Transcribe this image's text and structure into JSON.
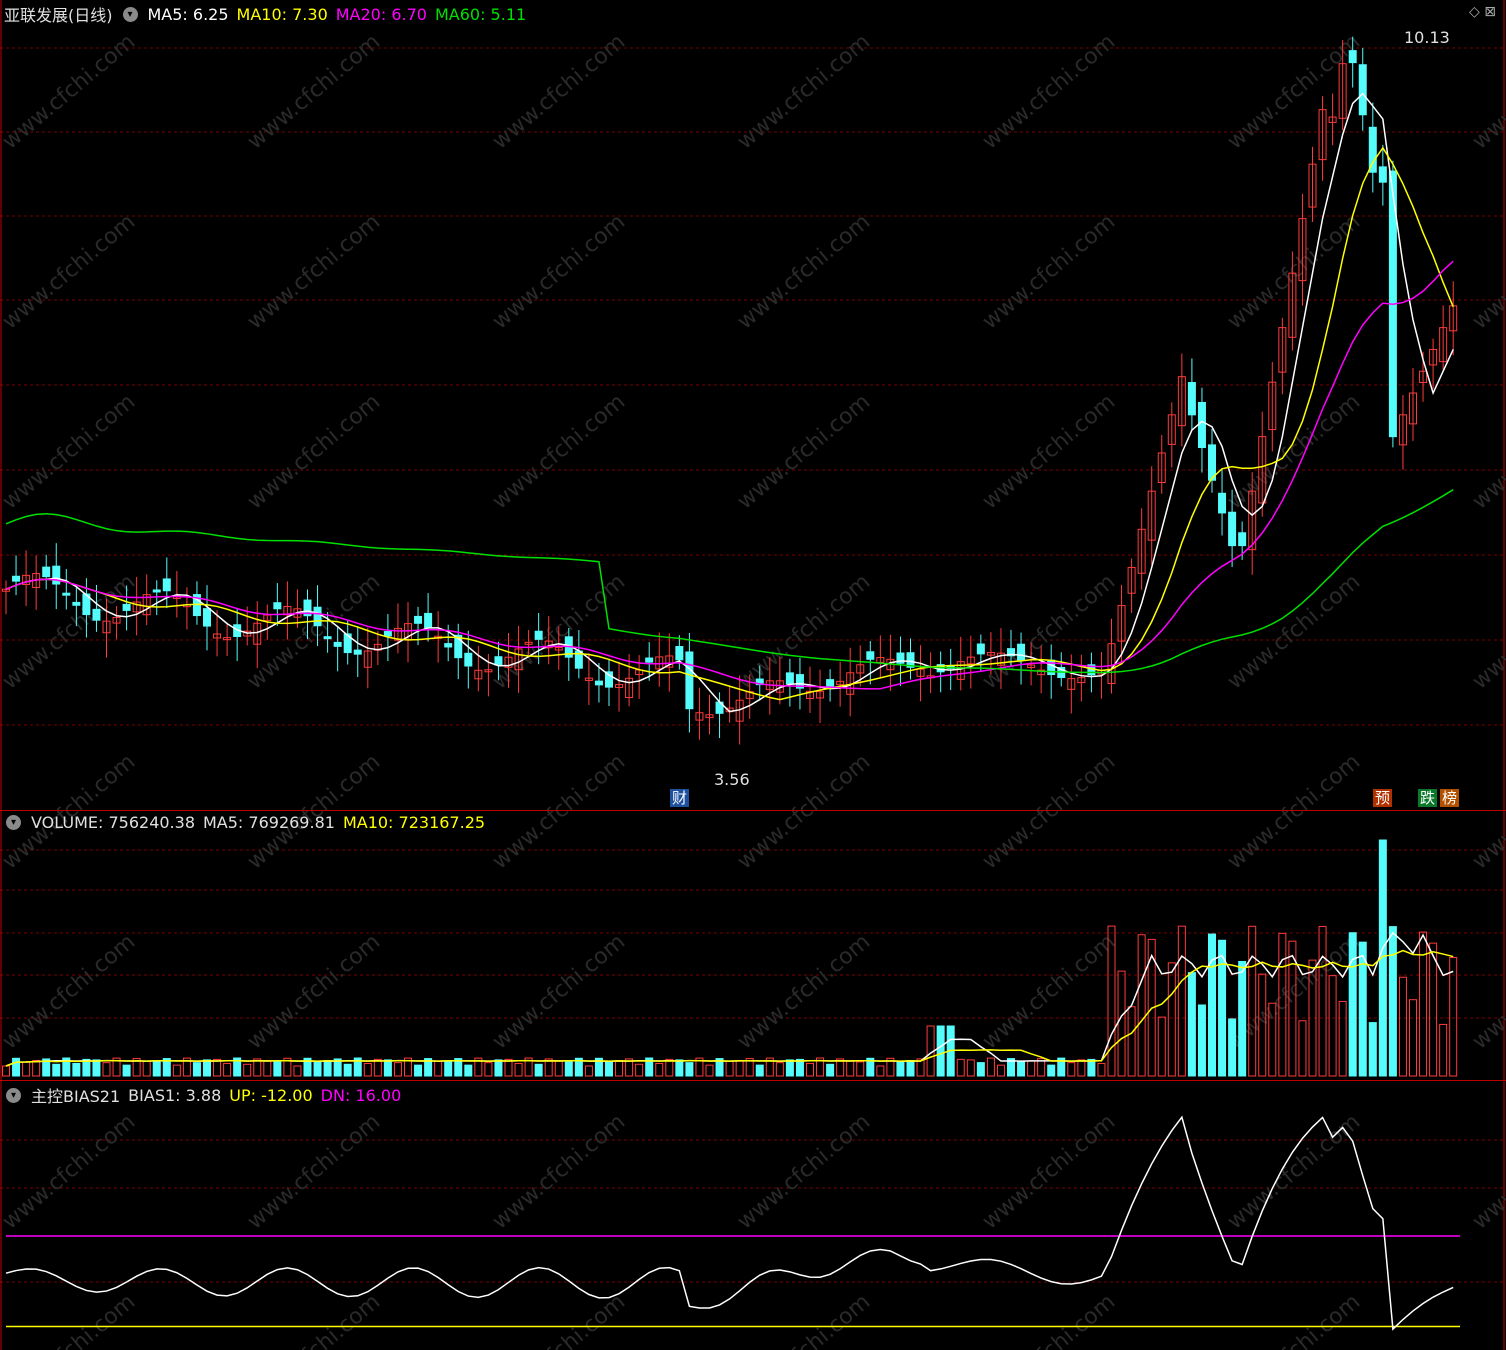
{
  "header": {
    "stock_name": "亚联发展(日线)",
    "ma5": "MA5: 6.25",
    "ma10": "MA10: 7.30",
    "ma20": "MA20: 6.70",
    "ma60": "MA60: 5.11"
  },
  "price_labels": {
    "high": "10.13",
    "low": "3.56"
  },
  "markers": {
    "cai": "财",
    "yu": "预",
    "die": "跌",
    "bang": "榜"
  },
  "volume_header": {
    "volume": "VOLUME: 756240.38",
    "ma5": "MA5: 769269.81",
    "ma10": "MA10: 723167.25"
  },
  "bias_header": {
    "name": "主控BIAS21",
    "bias1": "BIAS1: 3.88",
    "up": "UP: -12.00",
    "dn": "DN: 16.00"
  },
  "colors": {
    "up_candle": "#ff3b3b",
    "down_candle": "#54fcfc",
    "ma5": "#ffffff",
    "ma10": "#ffff00",
    "ma20": "#ff00ff",
    "ma60": "#00e000",
    "grid": "#7a0000",
    "separator": "#c00000"
  },
  "watermark": "www.cfchi.com"
}
